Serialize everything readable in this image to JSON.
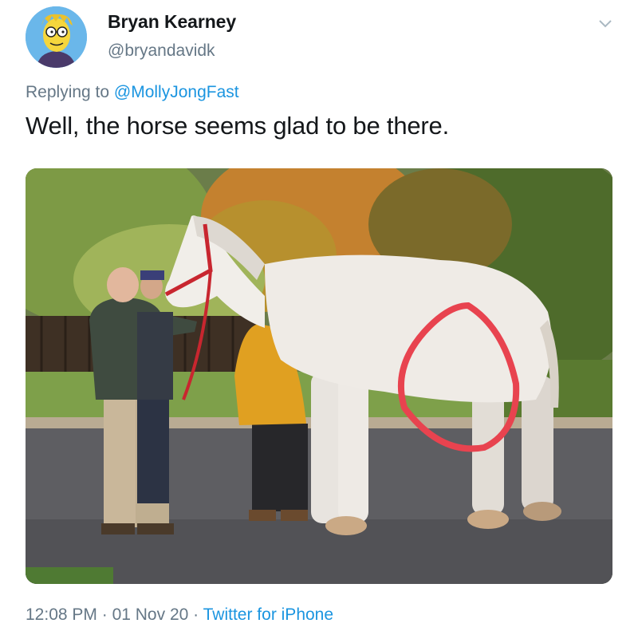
{
  "author": {
    "display_name": "Bryan Kearney",
    "handle": "@bryandavidk",
    "avatar_icon": "cartoon-avatar-icon"
  },
  "reply": {
    "prefix": "Replying to",
    "mention": "@MollyJongFast"
  },
  "tweet": {
    "text": "Well, the horse seems glad to be there."
  },
  "media": {
    "kind": "photo"
  },
  "footer": {
    "time": "12:08 PM",
    "separator": "·",
    "date": "01 Nov 20",
    "source": "Twitter for iPhone"
  },
  "colors": {
    "link": "#1b95e0",
    "secondary_text": "#657786",
    "primary_text": "#14171a",
    "annotation_circle": "#e8434f"
  },
  "icons": {
    "menu": "chevron-down-icon"
  }
}
